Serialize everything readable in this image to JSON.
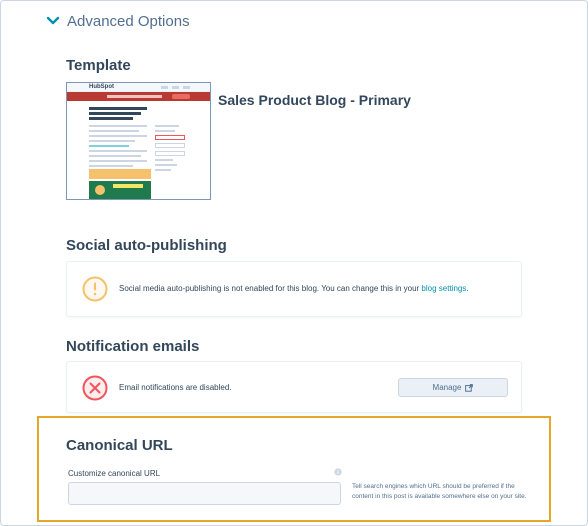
{
  "advanced": {
    "label": "Advanced Options"
  },
  "template": {
    "title": "Template",
    "name": "Sales Product Blog - Primary",
    "thumb_logo": "HubSpot"
  },
  "social": {
    "title": "Social auto-publishing",
    "message": "Social media auto-publishing is not enabled for this blog. You can change this in your ",
    "link": "blog settings",
    "suffix": "."
  },
  "notifications": {
    "title": "Notification emails",
    "message": "Email notifications are disabled.",
    "manage_label": "Manage"
  },
  "canonical": {
    "title": "Canonical URL",
    "field_label": "Customize canonical URL",
    "value": "",
    "placeholder": "",
    "help": "Tell search engines which URL should be preferred if the content in this post is available somewhere else on your site."
  },
  "colors": {
    "warning": "#f5c26b",
    "error": "#f2545b",
    "highlight": "#e4a72b",
    "link": "#0091ae"
  },
  "icons": {
    "advanced": "chevron-down-icon",
    "social": "warning-icon",
    "notifications": "error-x-icon",
    "manage": "external-link-icon",
    "canonical": "info-icon"
  }
}
